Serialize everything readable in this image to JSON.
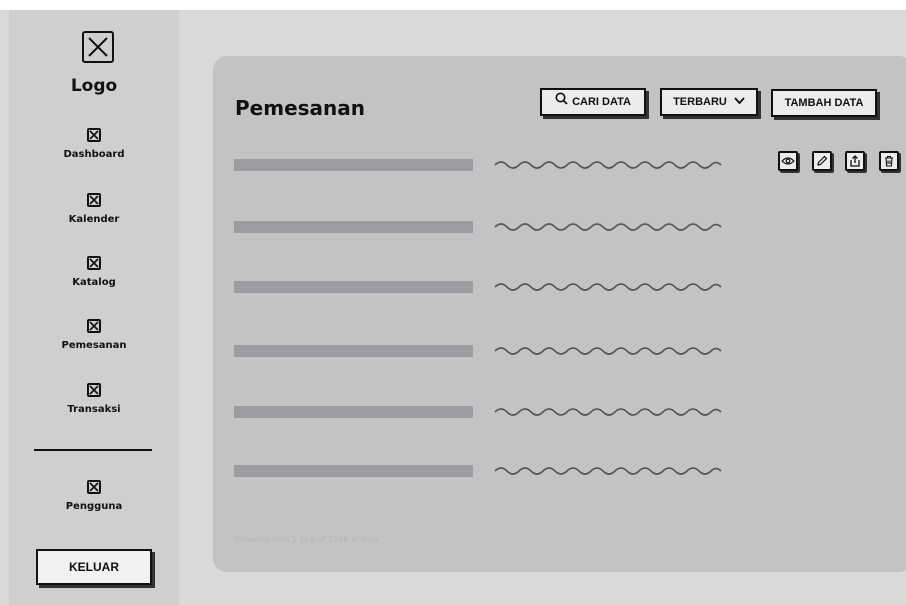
{
  "sidebar": {
    "logo_label": "Logo",
    "items": [
      {
        "label": "Dashboard"
      },
      {
        "label": "Kalender"
      },
      {
        "label": "Katalog"
      },
      {
        "label": "Pemesanan"
      },
      {
        "label": "Transaksi"
      },
      {
        "label": "Pengguna"
      }
    ],
    "logout_label": "KELUAR"
  },
  "main": {
    "title": "Pemesanan",
    "search_label": "CARI DATA",
    "sort_label": "TERBARU",
    "add_label": "TAMBAH DATA",
    "footer_text": "Showing data 1 to 6 of 256K entries",
    "row_count": 6
  },
  "icons": {
    "logo": "image-placeholder-icon",
    "nav": "placeholder-x-icon",
    "search": "search-icon",
    "sort": "chevron-down-icon",
    "actions": [
      "view-eye-icon",
      "edit-pencil-icon",
      "export-upload-icon",
      "delete-trash-icon"
    ]
  },
  "colors": {
    "sidebar": "#cfcfcf",
    "panel": "#c3c3c3",
    "row_bar": "#9e9ca3",
    "button": "#ececec"
  }
}
